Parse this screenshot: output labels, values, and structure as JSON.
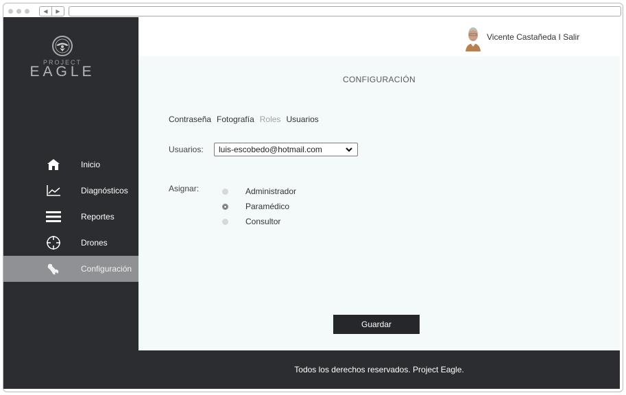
{
  "browser": {
    "nav_back": "◀",
    "nav_forward": "▶"
  },
  "brand": {
    "line1": "PROJECT",
    "line2": "EAGLE",
    "emblem_icon": "eagle-emblem-icon"
  },
  "sidebar": {
    "items": [
      {
        "label": "Inicio",
        "icon": "home-icon",
        "active": false
      },
      {
        "label": "Diagnósticos",
        "icon": "line-chart-icon",
        "active": false
      },
      {
        "label": "Reportes",
        "icon": "list-bars-icon",
        "active": false
      },
      {
        "label": "Drones",
        "icon": "crosshair-icon",
        "active": false
      },
      {
        "label": "Configuración",
        "icon": "wrench-icon",
        "active": true
      }
    ]
  },
  "header": {
    "user_text": "Vicente Castañeda I Salir"
  },
  "main": {
    "title": "CONFIGURACIÓN",
    "tabs": [
      {
        "label": "Contraseña",
        "current": false
      },
      {
        "label": "Fotografía",
        "current": false
      },
      {
        "label": "Roles",
        "current": true
      },
      {
        "label": "Usuarios",
        "current": false
      }
    ],
    "users_label": "Usuarios:",
    "users_value": "luis-escobedo@hotmail.com",
    "assign_label": "Asignar:",
    "roles": [
      {
        "label": "Administrador",
        "checked": false
      },
      {
        "label": "Paramédico",
        "checked": true
      },
      {
        "label": "Consultor",
        "checked": false
      }
    ],
    "save_label": "Guardar"
  },
  "footer": {
    "text": "Todos los derechos reservados. Project Eagle."
  },
  "colors": {
    "sidebar_bg": "#2b2d30",
    "active_item_bg": "#909194",
    "main_bg": "#f4f9f9",
    "button_bg": "#25272a"
  }
}
